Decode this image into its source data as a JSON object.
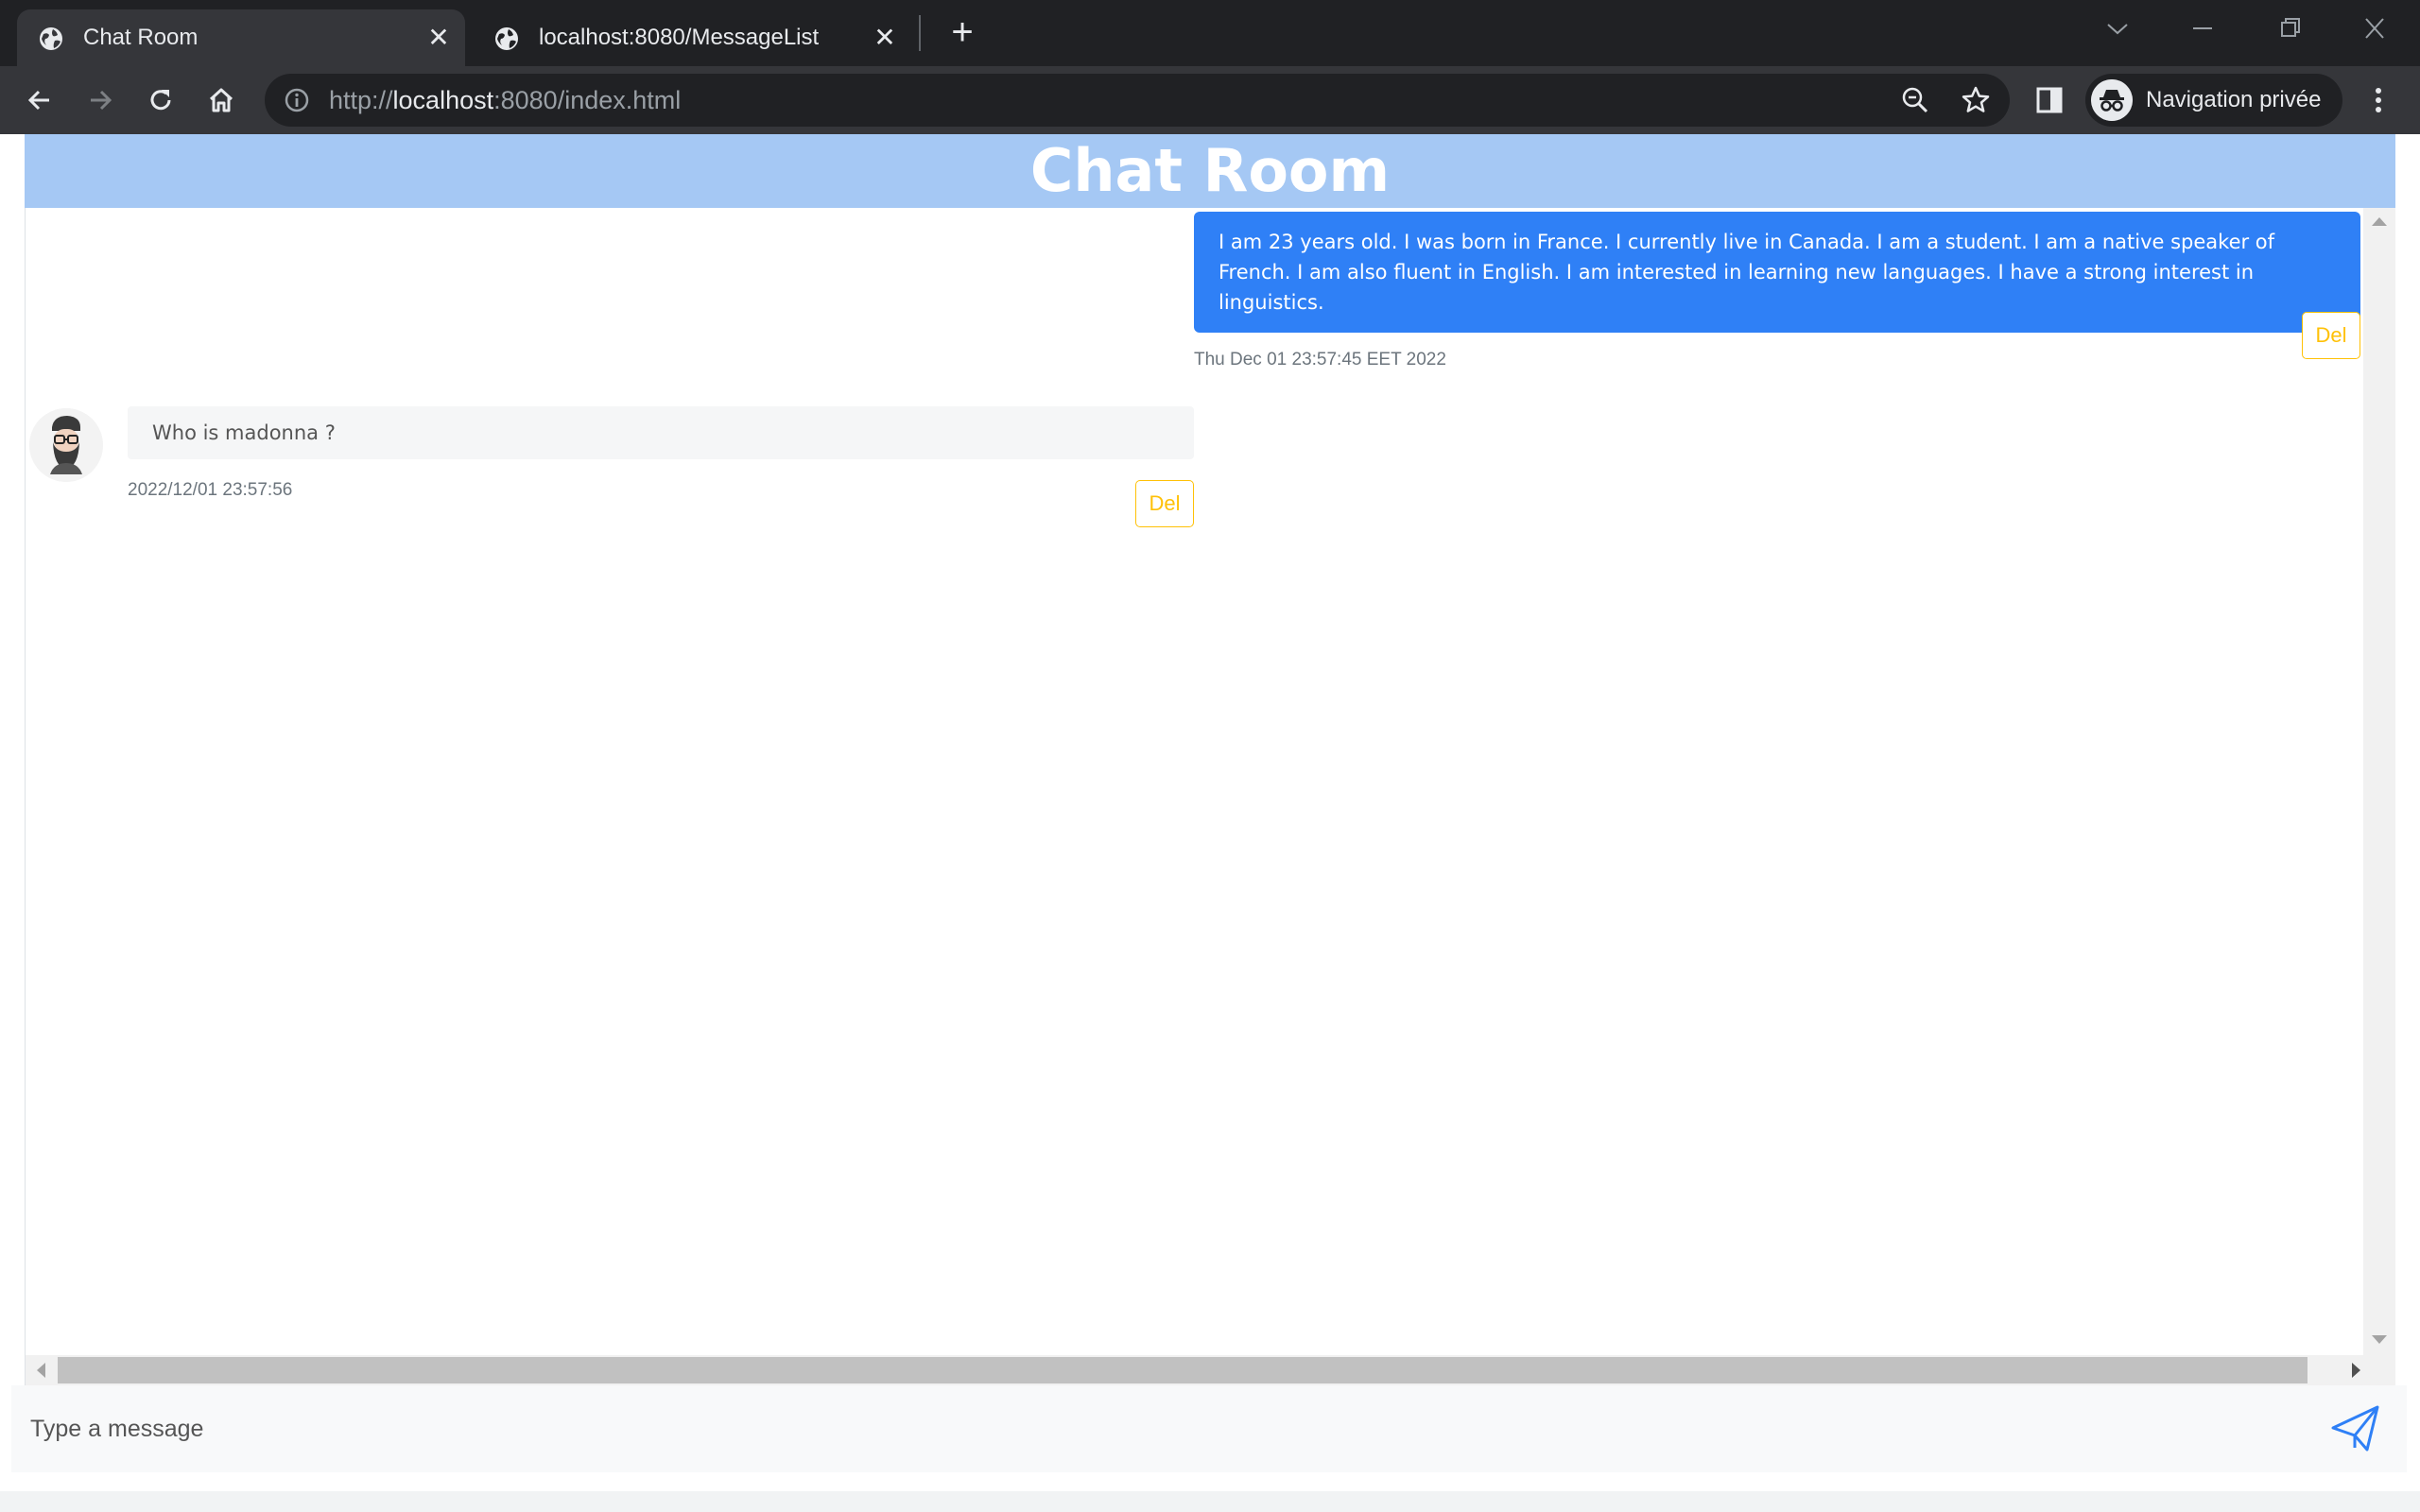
{
  "browser": {
    "tabs": [
      {
        "title": "Chat Room",
        "icon": "globe-icon",
        "active": true
      },
      {
        "title": "localhost:8080/MessageList",
        "icon": "globe-icon",
        "active": false
      }
    ],
    "address_bar": {
      "scheme": "http://",
      "host": "localhost",
      "path": ":8080/index.html"
    },
    "profile_label": "Navigation privée"
  },
  "colors": {
    "header_bg": "#a5c8f4",
    "sent_bubble": "#2f80f6",
    "del_button": "#ffc107"
  },
  "chat": {
    "title": "Chat Room",
    "messages": [
      {
        "direction": "sent",
        "text": "I am 23 years old. I was born in France. I currently live in Canada. I am a student. I am a native speaker of French. I am also fluent in English. I am interested in learning new languages. I have a strong interest in linguistics.",
        "timestamp": "Thu Dec 01 23:57:45 EET 2022",
        "delete_label": "Del"
      },
      {
        "direction": "received",
        "avatar": "bearded-man-avatar",
        "text": "Who is madonna ?",
        "timestamp": "2022/12/01 23:57:56",
        "delete_label": "Del"
      }
    ]
  },
  "composer": {
    "placeholder": "Type a message",
    "value": "",
    "send_icon": "paper-plane-icon"
  }
}
